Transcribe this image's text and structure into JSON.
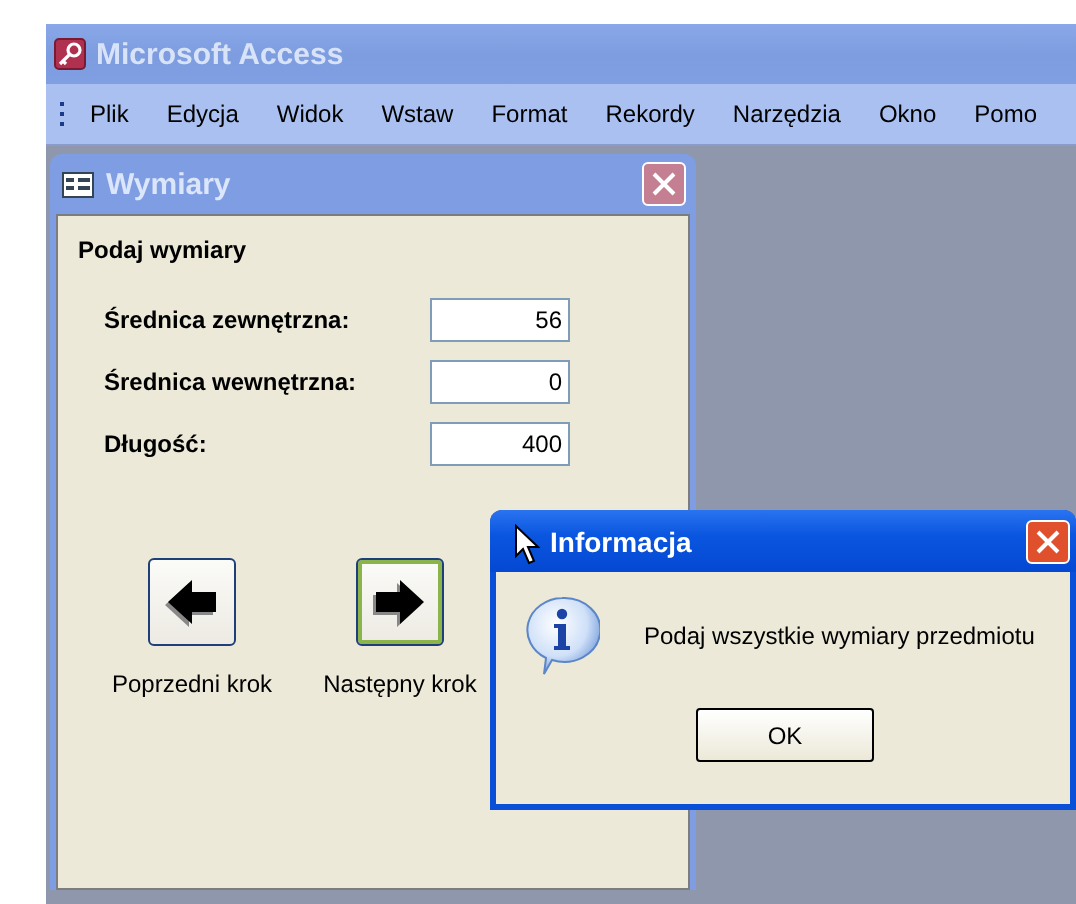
{
  "app": {
    "title": "Microsoft Access",
    "active": false
  },
  "menu": [
    {
      "label": "Plik"
    },
    {
      "label": "Edycja"
    },
    {
      "label": "Widok"
    },
    {
      "label": "Wstaw"
    },
    {
      "label": "Format"
    },
    {
      "label": "Rekordy"
    },
    {
      "label": "Narzędzia"
    },
    {
      "label": "Okno"
    },
    {
      "label": "Pomo"
    }
  ],
  "form": {
    "title": "Wymiary",
    "active": false,
    "heading": "Podaj wymiary",
    "fields": [
      {
        "label": "Średnica zewnętrzna:",
        "value": "56"
      },
      {
        "label": "Średnica wewnętrzna:",
        "value": "0"
      },
      {
        "label": "Długość:",
        "value": "400"
      }
    ],
    "nav_buttons": [
      {
        "label": "Poprzedni krok",
        "kind": "back",
        "focused": false
      },
      {
        "label": "Następny krok",
        "kind": "next",
        "focused": true
      }
    ]
  },
  "dialog": {
    "title": "Informacja",
    "active": true,
    "kind": "information",
    "message": "Podaj wszystkie wymiary przedmiotu",
    "buttons": [
      "OK"
    ]
  }
}
